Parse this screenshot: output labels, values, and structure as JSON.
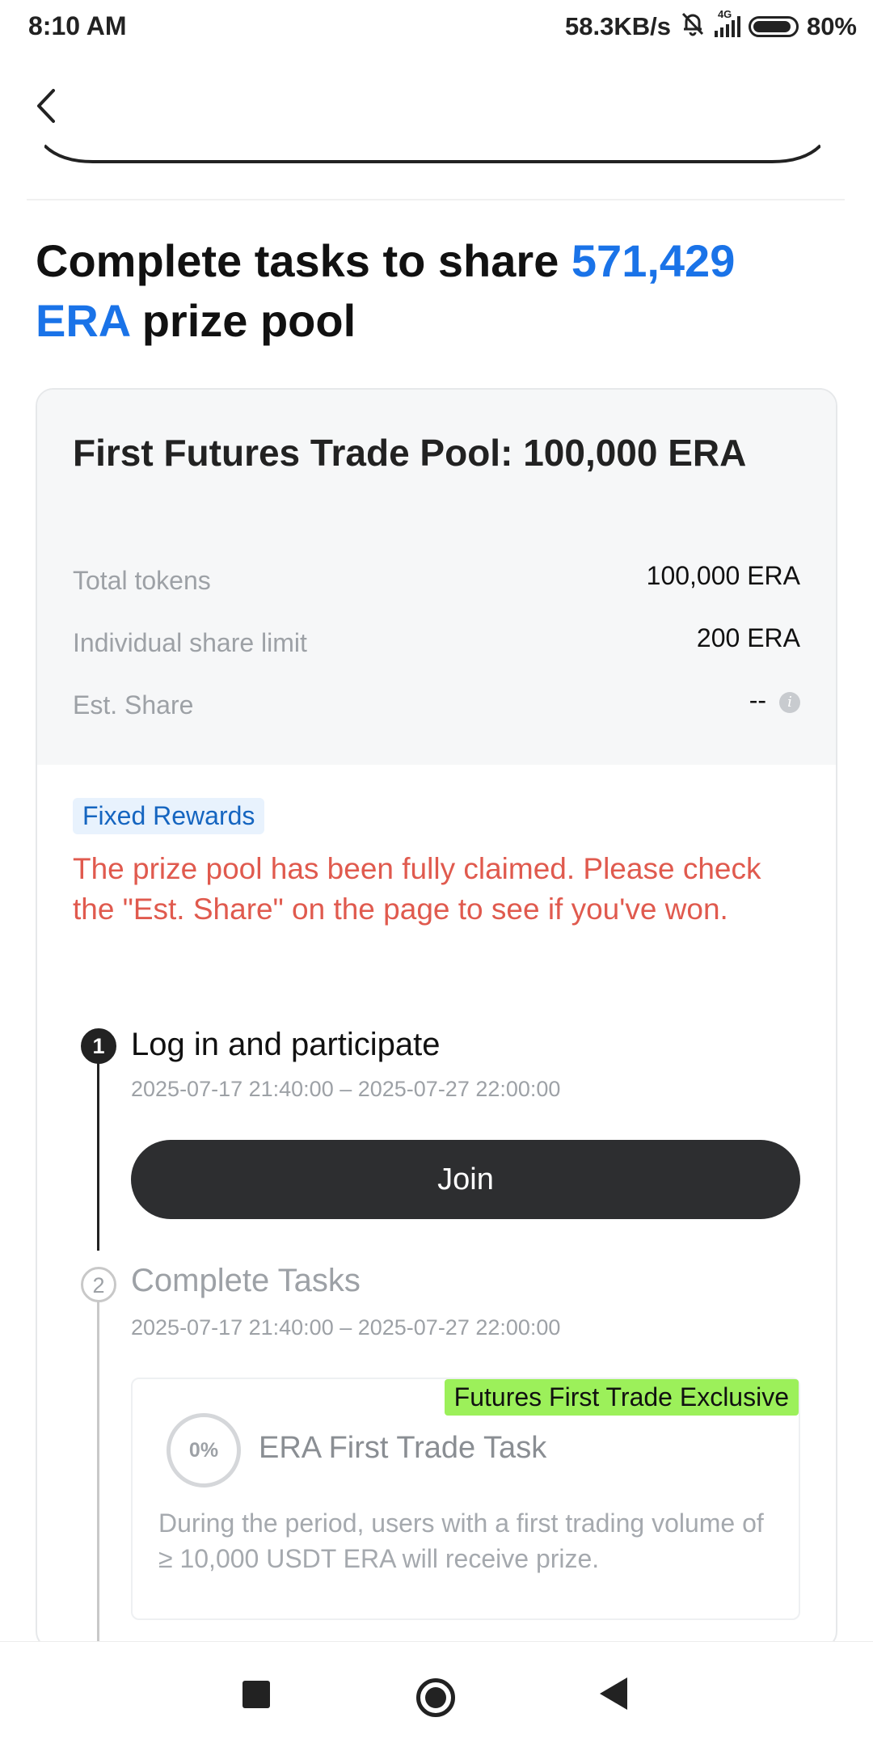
{
  "status_bar": {
    "time": "8:10 AM",
    "network_speed": "58.3KB/s",
    "network_type": "4G",
    "battery": "80%",
    "icons": [
      "mute-bell-icon",
      "signal-icon",
      "battery-icon"
    ]
  },
  "header": {
    "back_icon": "chevron-left-icon"
  },
  "headline": {
    "prefix": "Complete tasks to share ",
    "amount": "571,429",
    "token": "ERA",
    "suffix": " prize pool",
    "accent_color": "#1a73e8"
  },
  "pool": {
    "title": "First Futures Trade Pool: 100,000 ERA",
    "rows": [
      {
        "label": "Total tokens",
        "value": "100,000 ERA"
      },
      {
        "label": "Individual share limit",
        "value": "200 ERA"
      },
      {
        "label": "Est. Share",
        "value": "--"
      }
    ],
    "badge": "Fixed Rewards",
    "notice": "The prize pool has been fully claimed. Please check the \"Est. Share\" on the page to see if you've won.",
    "notice_color": "#e05a4e"
  },
  "steps": [
    {
      "number": "1",
      "title": "Log in and participate",
      "date_range": "2025-07-17 21:40:00 – 2025-07-27 22:00:00",
      "button": "Join"
    },
    {
      "number": "2",
      "title": "Complete Tasks",
      "date_range": "2025-07-17 21:40:00 – 2025-07-27 22:00:00"
    }
  ],
  "task": {
    "tag": "Futures First Trade Exclusive",
    "tag_color": "#9cf05a",
    "progress": "0%",
    "title": "ERA First Trade Task",
    "description": "During the period, users with a first trading volume of ≥ 10,000 USDT ERA will receive prize."
  },
  "nav_bar": {
    "icons": [
      "recents-square-icon",
      "home-circle-icon",
      "back-triangle-icon"
    ]
  }
}
